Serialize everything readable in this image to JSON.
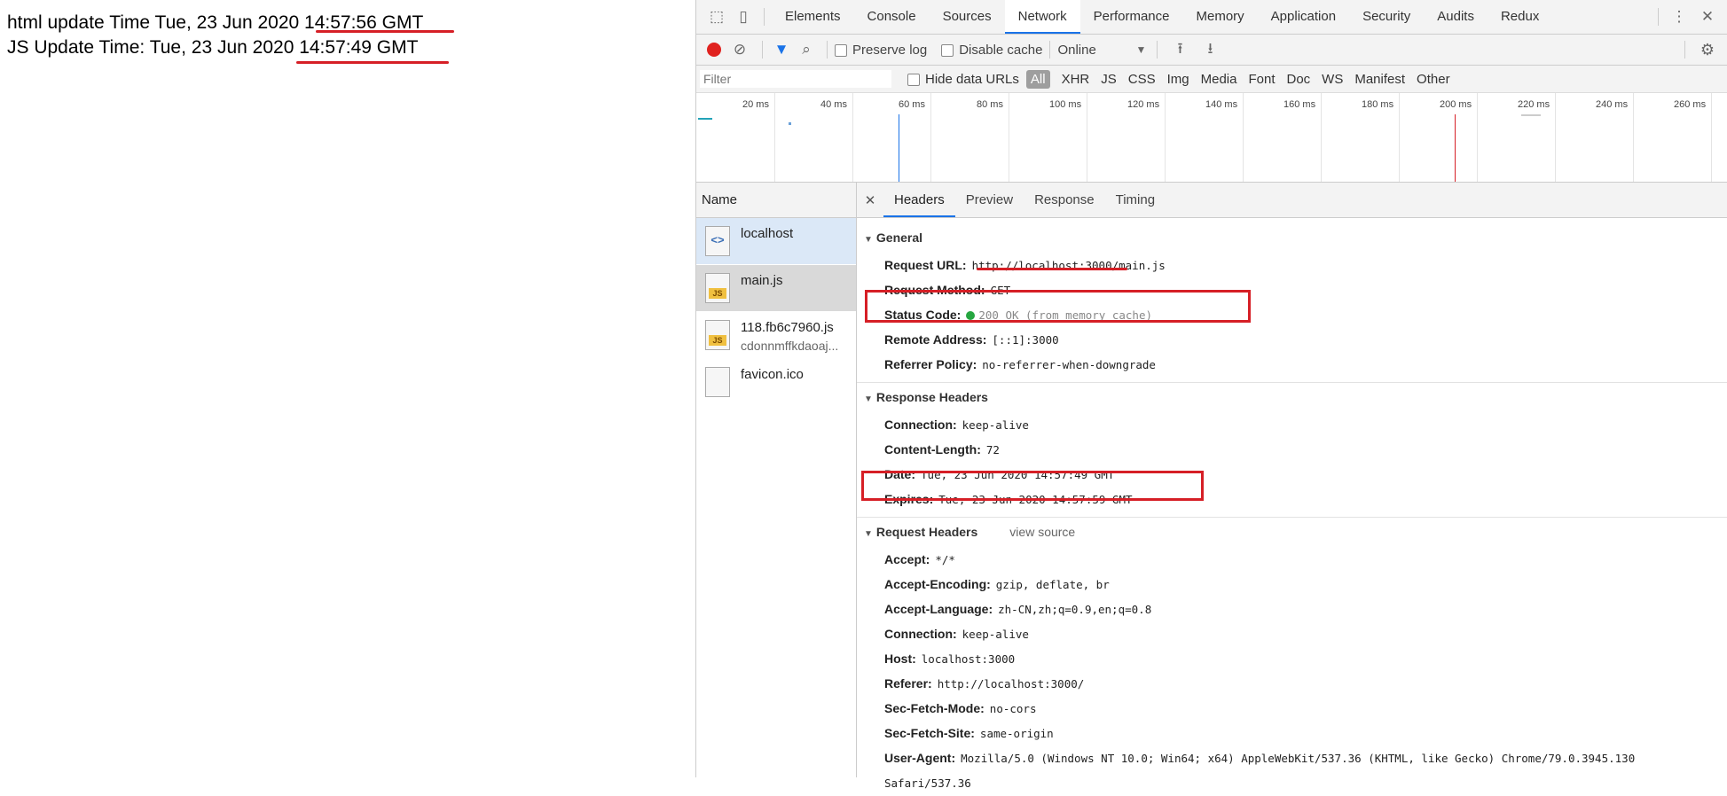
{
  "page": {
    "html_update": "html update Time Tue, 23 Jun 2020 14:57:56 GMT",
    "js_update": "JS Update Time: Tue, 23 Jun 2020 14:57:49 GMT"
  },
  "devtools": {
    "tabs": [
      "Elements",
      "Console",
      "Sources",
      "Network",
      "Performance",
      "Memory",
      "Application",
      "Security",
      "Audits",
      "Redux"
    ],
    "active_tab": "Network",
    "toolbar": {
      "preserve_log": "Preserve log",
      "disable_cache": "Disable cache",
      "throttle": "Online"
    },
    "filter": {
      "placeholder": "Filter",
      "hide_data_urls": "Hide data URLs",
      "types": [
        "All",
        "XHR",
        "JS",
        "CSS",
        "Img",
        "Media",
        "Font",
        "Doc",
        "WS",
        "Manifest",
        "Other"
      ]
    },
    "timeline": {
      "ticks": [
        "20 ms",
        "40 ms",
        "60 ms",
        "80 ms",
        "100 ms",
        "120 ms",
        "140 ms",
        "160 ms",
        "180 ms",
        "200 ms",
        "220 ms",
        "240 ms",
        "260 ms"
      ]
    },
    "requests": {
      "header": "Name",
      "items": [
        {
          "name": "localhost",
          "sub": ""
        },
        {
          "name": "main.js",
          "sub": ""
        },
        {
          "name": "118.fb6c7960.js",
          "sub": "cdonnmffkdaoaj..."
        },
        {
          "name": "favicon.ico",
          "sub": ""
        }
      ]
    },
    "detail_tabs": [
      "Headers",
      "Preview",
      "Response",
      "Timing"
    ],
    "general": {
      "title": "General",
      "rows": [
        {
          "k": "Request URL:",
          "v": "http://localhost:3000/main.js"
        },
        {
          "k": "Request Method:",
          "v": "GET"
        },
        {
          "k": "Status Code:",
          "v": "200 OK (from memory cache)"
        },
        {
          "k": "Remote Address:",
          "v": "[::1]:3000"
        },
        {
          "k": "Referrer Policy:",
          "v": "no-referrer-when-downgrade"
        }
      ]
    },
    "response_headers": {
      "title": "Response Headers",
      "rows": [
        {
          "k": "Connection:",
          "v": "keep-alive"
        },
        {
          "k": "Content-Length:",
          "v": "72"
        },
        {
          "k": "Date:",
          "v": "Tue, 23 Jun 2020 14:57:49 GMT"
        },
        {
          "k": "Expires:",
          "v": "Tue, 23 Jun 2020 14:57:59 GMT"
        }
      ]
    },
    "request_headers": {
      "title": "Request Headers",
      "view_source": "view source",
      "rows": [
        {
          "k": "Accept:",
          "v": "*/*"
        },
        {
          "k": "Accept-Encoding:",
          "v": "gzip, deflate, br"
        },
        {
          "k": "Accept-Language:",
          "v": "zh-CN,zh;q=0.9,en;q=0.8"
        },
        {
          "k": "Connection:",
          "v": "keep-alive"
        },
        {
          "k": "Host:",
          "v": "localhost:3000"
        },
        {
          "k": "Referer:",
          "v": "http://localhost:3000/"
        },
        {
          "k": "Sec-Fetch-Mode:",
          "v": "no-cors"
        },
        {
          "k": "Sec-Fetch-Site:",
          "v": "same-origin"
        },
        {
          "k": "User-Agent:",
          "v": "Mozilla/5.0 (Windows NT 10.0; Win64; x64) AppleWebKit/537.36 (KHTML, like Gecko) Chrome/79.0.3945.130"
        },
        {
          "k": "",
          "v": "Safari/537.36"
        }
      ]
    }
  },
  "colors": {
    "annotation_red": "#d61f26",
    "record_red": "#e0221f",
    "status_green": "#26a640",
    "accent_blue": "#1a73e8"
  }
}
